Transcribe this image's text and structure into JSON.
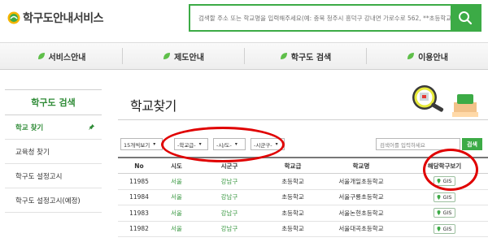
{
  "header": {
    "logo_text": "학구도안내서비스",
    "search_placeholder": "검색할 주소 또는 학교명을 입력해주세요(예: 충북 청주시 흥덕구 강내면 가로수로 562, **초등학교)"
  },
  "nav": {
    "items": [
      {
        "label": "서비스안내",
        "icon": "leaf-icon"
      },
      {
        "label": "제도안내",
        "icon": "leaf-icon"
      },
      {
        "label": "학구도 검색",
        "icon": "leaf-icon"
      },
      {
        "label": "이용안내",
        "icon": "leaf-icon"
      }
    ]
  },
  "sidebar": {
    "title": "학구도 검색",
    "items": [
      {
        "label": "학교 찾기",
        "active": true
      },
      {
        "label": "교육청 찾기"
      },
      {
        "label": "학구도 설정고시"
      },
      {
        "label": "학구도 설정고시(예정)"
      }
    ]
  },
  "main": {
    "title": "학교찾기",
    "filters": {
      "page_size": "15개씩보기",
      "grade": "-학교급-",
      "sido": "-시/도-",
      "sigungu": "-시군구-"
    },
    "find_placeholder": "검색어를 입력하세요",
    "find_button": "검색"
  },
  "table": {
    "headers": [
      "No",
      "시도",
      "시군구",
      "학교급",
      "학교명",
      "해당학구보기"
    ],
    "rows": [
      {
        "no": "11985",
        "sido": "서울",
        "sigungu": "강남구",
        "grade": "초등학교",
        "name": "서울개일초등학교",
        "gis": "GIS"
      },
      {
        "no": "11984",
        "sido": "서울",
        "sigungu": "강남구",
        "grade": "초등학교",
        "name": "서울구룡초등학교",
        "gis": "GIS"
      },
      {
        "no": "11983",
        "sido": "서울",
        "sigungu": "강남구",
        "grade": "초등학교",
        "name": "서울논현초등학교",
        "gis": "GIS"
      },
      {
        "no": "11982",
        "sido": "서울",
        "sigungu": "강남구",
        "grade": "초등학교",
        "name": "서울대곡초등학교",
        "gis": "GIS"
      }
    ]
  },
  "colors": {
    "accent": "#3cab46",
    "highlight": "#e00000"
  }
}
